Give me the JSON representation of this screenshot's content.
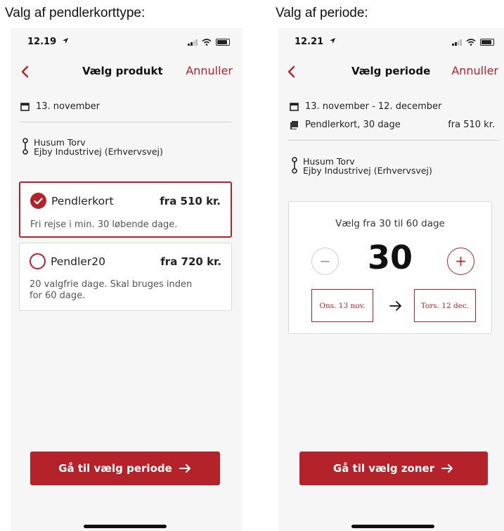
{
  "captions": {
    "left": "Valg af pendlerkorttype:",
    "right": "Valg af periode:"
  },
  "colors": {
    "accent": "#b4232a",
    "background": "#f6f6f6",
    "card": "#ffffff"
  },
  "left_screen": {
    "status": {
      "time": "12.19"
    },
    "nav": {
      "title": "Vælg produkt",
      "cancel": "Annuller"
    },
    "date": "13. november",
    "route": {
      "from": "Husum Torv",
      "to": "Ejby Industrivej (Erhvervsvej)"
    },
    "options": [
      {
        "name": "Pendlerkort",
        "price": "fra 510 kr.",
        "description": "Fri rejse i min. 30 løbende dage.",
        "selected": true
      },
      {
        "name": "Pendler20",
        "price": "fra 720 kr.",
        "description_line1": "20 valgfrie dage. Skal bruges inden",
        "description_line2": "for 60 dage.",
        "selected": false
      }
    ],
    "button": "Gå til vælg periode"
  },
  "right_screen": {
    "status": {
      "time": "12.21"
    },
    "nav": {
      "title": "Vælg periode",
      "cancel": "Annuller"
    },
    "date_range": "13. november - 12. december",
    "product": {
      "label": "Pendlerkort, 30 dage",
      "price": "fra 510 kr."
    },
    "route": {
      "from": "Husum Torv",
      "to": "Ejby Industrivej (Erhvervsvej)"
    },
    "period": {
      "label": "Vælg fra 30 til 60 dage",
      "value": "30",
      "minus": "−",
      "plus": "+",
      "start_date": "Ons. 13 nov.",
      "end_date": "Tors. 12 dec."
    },
    "button": "Gå til vælg zoner"
  },
  "icons": [
    "back-chevron-icon",
    "calendar-icon",
    "route-icon",
    "ticket-icon",
    "check-icon",
    "arrow-right-icon",
    "signal-icon",
    "wifi-icon",
    "battery-icon",
    "location-arrow-icon"
  ]
}
